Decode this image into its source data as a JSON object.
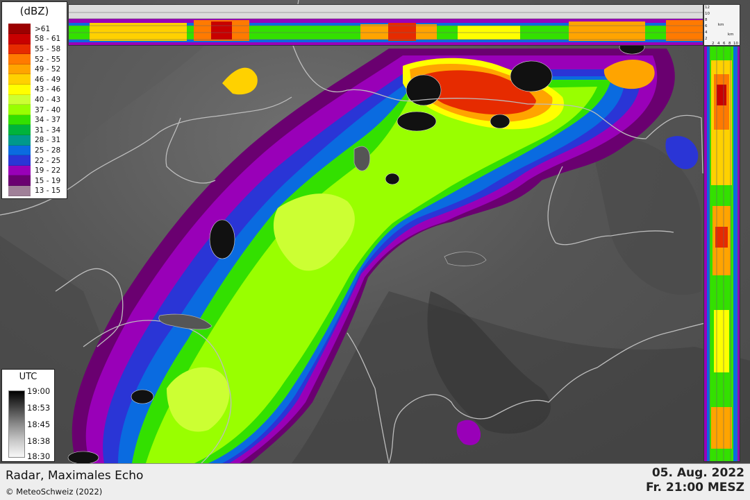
{
  "legend_dbz": {
    "title": "(dBZ)",
    "classes": [
      {
        "label": ">61",
        "color": "#9b0000"
      },
      {
        "label": "58 - 61",
        "color": "#c80000"
      },
      {
        "label": "55 - 58",
        "color": "#e62b00"
      },
      {
        "label": "52 - 55",
        "color": "#ff7a00"
      },
      {
        "label": "49 - 52",
        "color": "#ffa400"
      },
      {
        "label": "46 - 49",
        "color": "#ffd100"
      },
      {
        "label": "43 - 46",
        "color": "#ffff00"
      },
      {
        "label": "40 - 43",
        "color": "#ccff33"
      },
      {
        "label": "37 - 40",
        "color": "#99ff00"
      },
      {
        "label": "34 - 37",
        "color": "#33e000"
      },
      {
        "label": "31 - 34",
        "color": "#00b33c"
      },
      {
        "label": "28 - 31",
        "color": "#00998c"
      },
      {
        "label": "25 - 28",
        "color": "#0a6be0"
      },
      {
        "label": "22 - 25",
        "color": "#2a35d6"
      },
      {
        "label": "19 - 22",
        "color": "#9900b8"
      },
      {
        "label": "15 - 19",
        "color": "#6a0070"
      },
      {
        "label": "13 - 15",
        "color": "#a08098"
      }
    ]
  },
  "legend_utc": {
    "title": "UTC",
    "ticks": [
      "19:00",
      "18:53",
      "18:45",
      "18:38",
      "18:30"
    ]
  },
  "xsec_scale": {
    "heights": [
      "12",
      "10",
      "8",
      "6",
      "4",
      "2"
    ],
    "km_labels": [
      "km",
      "km"
    ],
    "distances": [
      "2",
      "4",
      "6",
      "8",
      "10"
    ]
  },
  "footer": {
    "title": "Radar, Maximales Echo",
    "copyright": "© MeteoSchweiz (2022)",
    "date": "05. Aug. 2022",
    "time": "Fr. 21:00 MESZ"
  }
}
